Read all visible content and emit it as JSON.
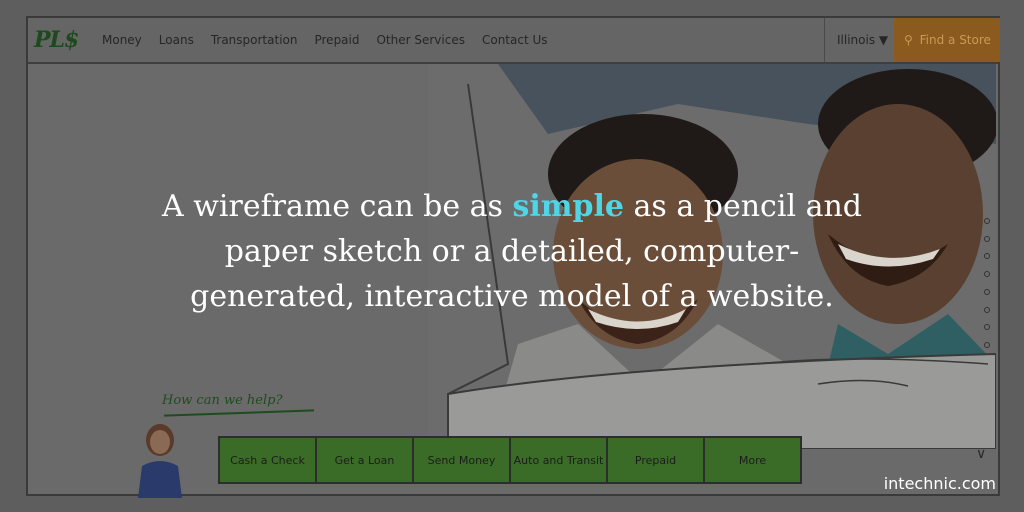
{
  "wireframe": {
    "logo": "PL$",
    "nav": [
      "Money",
      "Loans",
      "Transportation",
      "Prepaid",
      "Other Services",
      "Contact Us"
    ],
    "state_selector": "Illinois ▼",
    "find_store": "Find a Store",
    "help_prompt": "How can we help?",
    "actions": [
      "Cash a Check",
      "Get a Loan",
      "Send Money",
      "Auto and Transit",
      "Prepaid",
      "More"
    ],
    "colors": {
      "logo_green": "#1c4a1c",
      "button_green": "#3a6b27",
      "find_store_bg": "#8a5a1e"
    }
  },
  "quote": {
    "line1_before": "A wireframe can be as ",
    "highlight": "simple",
    "line1_after": " as a pencil and",
    "line2": "paper sketch or a detailed, computer-",
    "line3": "generated, interactive model of a website.",
    "highlight_color": "#4fd6e6"
  },
  "watermark": "intechnic.com"
}
